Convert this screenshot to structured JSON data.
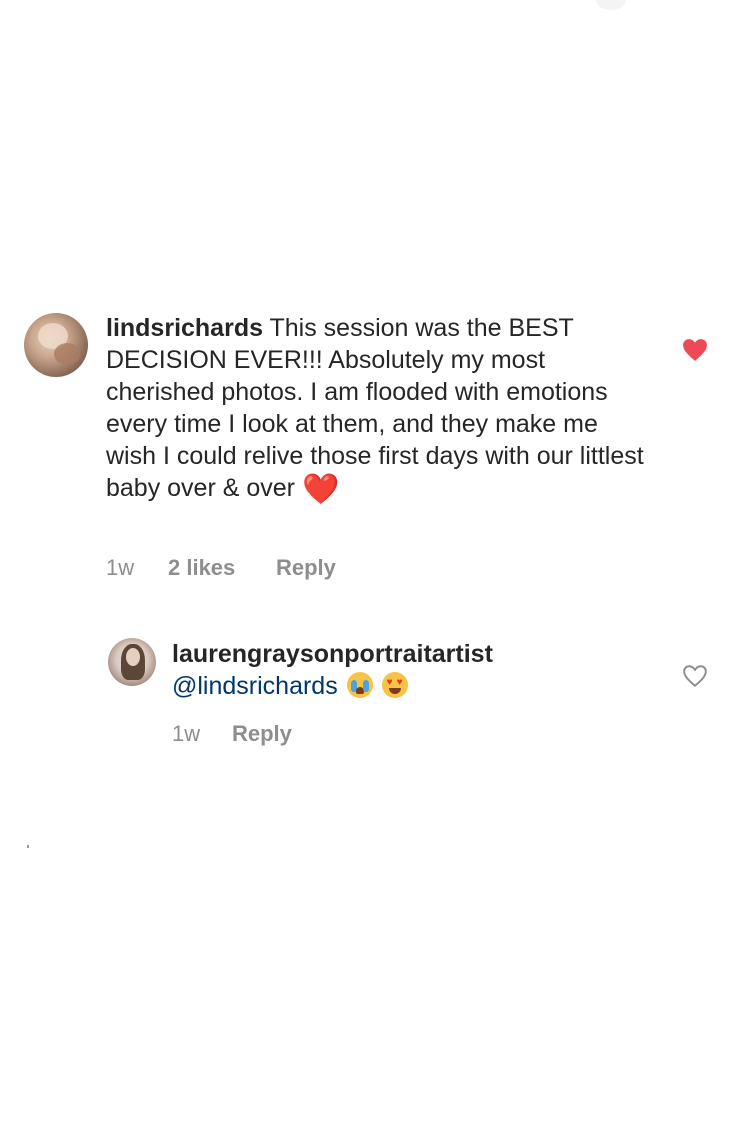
{
  "comments": [
    {
      "username": "lindsrichards",
      "body_text": " This session was the BEST DECISION EVER!!! Absolutely my most cherished photos. I am flooded with emotions every time I look at them, and they make me wish I could relive those first days with our littlest baby over & over ",
      "emoji": "❤️",
      "time": "1w",
      "likes": "2 likes",
      "reply_label": "Reply",
      "liked": true,
      "like_icon": "heart-filled-icon",
      "heart_color": "#ed4956"
    },
    {
      "username": "laurengraysonportraitartist",
      "mention": "@lindsrichards",
      "emojis": [
        "😭",
        "😍"
      ],
      "time": "1w",
      "reply_label": "Reply",
      "liked": false,
      "like_icon": "heart-outline-icon"
    }
  ],
  "colors": {
    "text": "#262626",
    "meta": "#8e8e8e",
    "mention": "#00376b",
    "background": "#ffffff"
  }
}
